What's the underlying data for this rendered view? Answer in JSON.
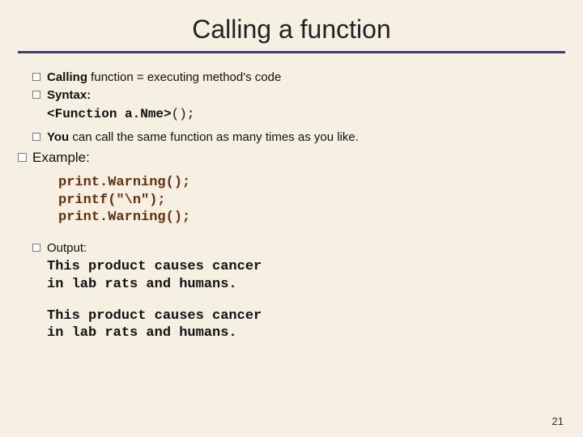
{
  "title": "Calling a function",
  "bullets": {
    "b1_lead": "Calling",
    "b1_rest": " function = executing method's code",
    "b2_lead": "Syntax:",
    "syntax_fn": "<Function a.Nme>",
    "syntax_paren": "();",
    "b3_lead": "You",
    "b3_rest": " can call the same function as many times as you like."
  },
  "example_label": "Example:",
  "code": {
    "l1": "print.Warning();",
    "l2": "printf(\"\\n\");",
    "l3": "print.Warning();"
  },
  "output_label": "Output:",
  "output": {
    "p1l1": "This product causes cancer",
    "p1l2": "in lab rats and humans.",
    "p2l1": "This product causes cancer",
    "p2l2": "in lab rats and humans."
  },
  "page_num": "21"
}
